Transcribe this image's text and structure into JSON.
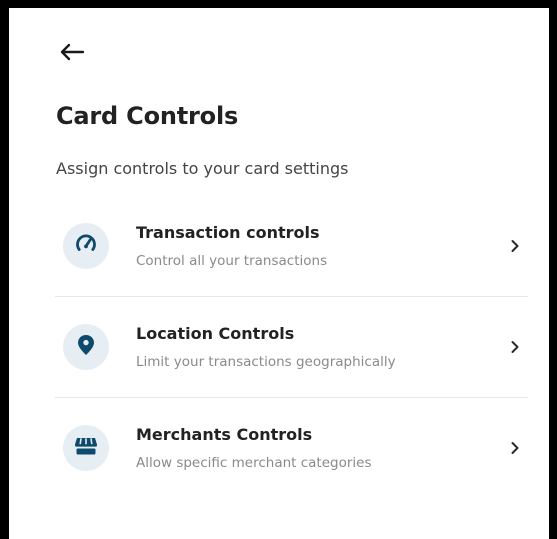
{
  "header": {
    "back_icon": "arrow-left-icon",
    "title": "Card Controls",
    "subtitle": "Assign controls to your card settings"
  },
  "controls": [
    {
      "icon": "speedometer-icon",
      "title": "Transaction controls",
      "description": "Control all your transactions"
    },
    {
      "icon": "location-pin-icon",
      "title": "Location Controls",
      "description": "Limit your transactions geographically"
    },
    {
      "icon": "storefront-icon",
      "title": "Merchants Controls",
      "description": "Allow specific merchant categories"
    }
  ],
  "colors": {
    "icon_fg": "#0d4a6b",
    "icon_bg": "#e6eef4",
    "text_primary": "#222222",
    "text_secondary": "#8a8a8a"
  }
}
